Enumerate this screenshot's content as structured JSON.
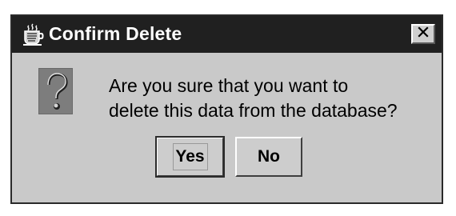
{
  "window": {
    "title": "Confirm Delete",
    "title_icon": "coffee-cup-icon",
    "close_icon": "close-icon"
  },
  "dialog": {
    "icon": "question-mark-icon",
    "message_lines": [
      "Are you sure that you want to",
      "delete this data from the database?"
    ],
    "buttons": {
      "yes": "Yes",
      "no": "No"
    }
  },
  "colors": {
    "titlebar": "#202020",
    "dialog_background": "#c9c9c9",
    "button_background": "#cdcdcd",
    "icon_background": "#7d7d7d"
  }
}
